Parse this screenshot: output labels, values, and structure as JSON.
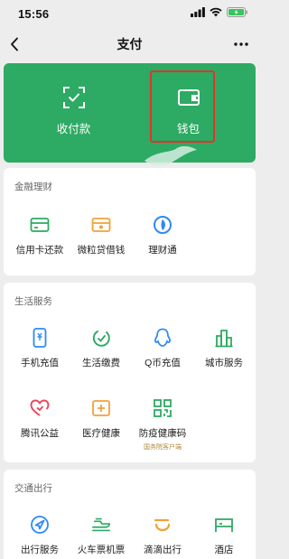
{
  "status_bar": {
    "time": "15:56"
  },
  "nav": {
    "title": "支付"
  },
  "top_card": {
    "items": [
      {
        "label": "收付款",
        "icon": "qr-scan-icon"
      },
      {
        "label": "钱包",
        "icon": "wallet-icon"
      }
    ],
    "accent": "#2daa63",
    "highlight_color": "#e0352a"
  },
  "sections": [
    {
      "title": "金融理财",
      "items": [
        {
          "label": "信用卡还款",
          "icon": "credit-card-icon"
        },
        {
          "label": "微粒贷借钱",
          "icon": "loan-icon"
        },
        {
          "label": "理财通",
          "icon": "wealth-icon"
        }
      ]
    },
    {
      "title": "生活服务",
      "items": [
        {
          "label": "手机充值",
          "icon": "phone-icon"
        },
        {
          "label": "生活缴费",
          "icon": "utility-icon"
        },
        {
          "label": "Q币充值",
          "icon": "penguin-icon"
        },
        {
          "label": "城市服务",
          "icon": "city-icon"
        },
        {
          "label": "腾讯公益",
          "icon": "heart-icon"
        },
        {
          "label": "医疗健康",
          "icon": "medical-icon"
        },
        {
          "label": "防疫健康码",
          "icon": "health-code-icon",
          "sub": "国务院客户端"
        }
      ]
    },
    {
      "title": "交通出行",
      "items": [
        {
          "label": "出行服务",
          "icon": "navigation-icon"
        },
        {
          "label": "火车票机票",
          "icon": "train-icon"
        },
        {
          "label": "滴滴出行",
          "icon": "didi-icon"
        },
        {
          "label": "酒店",
          "icon": "hotel-icon"
        }
      ]
    }
  ]
}
